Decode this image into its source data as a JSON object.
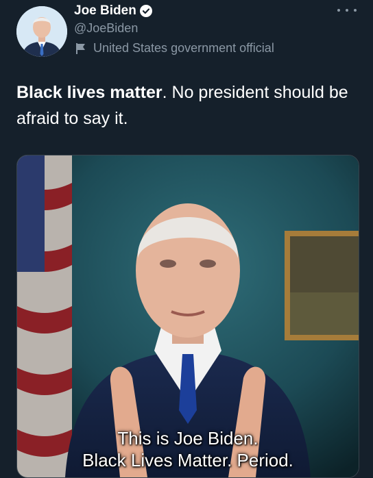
{
  "tweet": {
    "author": {
      "display_name": "Joe Biden",
      "handle": "@JoeBiden",
      "label": "United States government official"
    },
    "text_bold": "Black lives matter",
    "text_rest": ". No president should be afraid to say it.",
    "media": {
      "caption_line1": "This is Joe Biden.",
      "caption_line2": "Black Lives Matter. Period."
    }
  },
  "colors": {
    "background": "#15202b",
    "secondary_text": "#8b98a5",
    "verified_blue": "#1d9bf0"
  },
  "icons": [
    "verified-badge-icon",
    "flag-icon",
    "more-options-icon"
  ]
}
